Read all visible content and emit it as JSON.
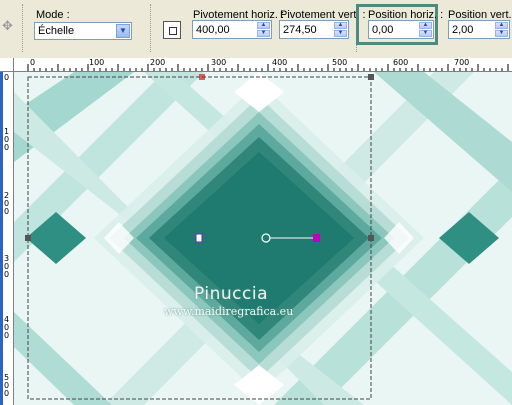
{
  "toolbar": {
    "mode": {
      "label": "Mode :",
      "value": "Échelle"
    },
    "pivot_h": {
      "label": "Pivotement horiz. :",
      "value": "400,00"
    },
    "pivot_v": {
      "label": "Pivotement vert. :",
      "value": "274,50"
    },
    "pos_h": {
      "label": "Position horiz. :",
      "value": "0,00"
    },
    "pos_v": {
      "label": "Position vert. :",
      "value": "2,00"
    }
  },
  "ruler": {
    "top_labels": [
      "0",
      "100",
      "200",
      "300",
      "400",
      "500",
      "600",
      "700"
    ],
    "left_labels": [
      "0",
      "1\n0\n0",
      "2\n0\n0",
      "3\n0\n0",
      "4\n0\n0",
      "5\n0\n0"
    ]
  },
  "watermark": {
    "name": "Pinuccia",
    "url": "www.maidiregrafica.eu"
  },
  "colors": {
    "teal_dark": "#1f7a6f",
    "teal_mid": "#46a89a",
    "teal_light": "#a9d9d0",
    "highlight": "#4f8a82"
  }
}
